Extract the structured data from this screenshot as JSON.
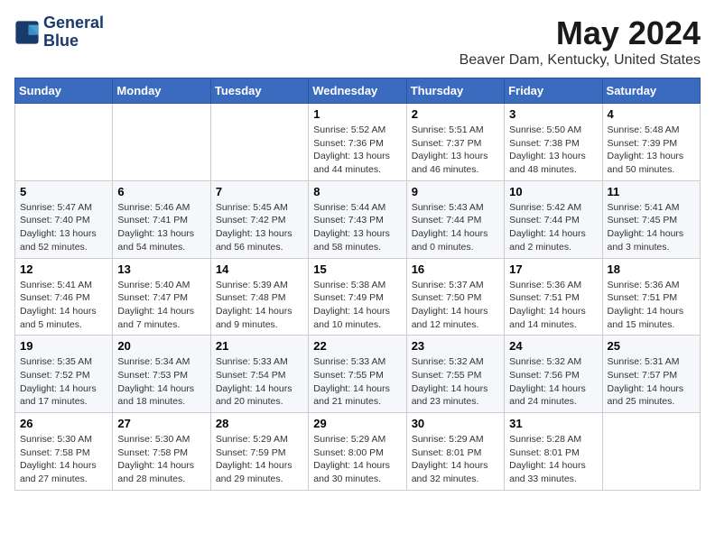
{
  "logo": {
    "line1": "General",
    "line2": "Blue"
  },
  "title": "May 2024",
  "subtitle": "Beaver Dam, Kentucky, United States",
  "weekdays": [
    "Sunday",
    "Monday",
    "Tuesday",
    "Wednesday",
    "Thursday",
    "Friday",
    "Saturday"
  ],
  "weeks": [
    [
      {
        "day": "",
        "info": ""
      },
      {
        "day": "",
        "info": ""
      },
      {
        "day": "",
        "info": ""
      },
      {
        "day": "1",
        "info": "Sunrise: 5:52 AM\nSunset: 7:36 PM\nDaylight: 13 hours\nand 44 minutes."
      },
      {
        "day": "2",
        "info": "Sunrise: 5:51 AM\nSunset: 7:37 PM\nDaylight: 13 hours\nand 46 minutes."
      },
      {
        "day": "3",
        "info": "Sunrise: 5:50 AM\nSunset: 7:38 PM\nDaylight: 13 hours\nand 48 minutes."
      },
      {
        "day": "4",
        "info": "Sunrise: 5:48 AM\nSunset: 7:39 PM\nDaylight: 13 hours\nand 50 minutes."
      }
    ],
    [
      {
        "day": "5",
        "info": "Sunrise: 5:47 AM\nSunset: 7:40 PM\nDaylight: 13 hours\nand 52 minutes."
      },
      {
        "day": "6",
        "info": "Sunrise: 5:46 AM\nSunset: 7:41 PM\nDaylight: 13 hours\nand 54 minutes."
      },
      {
        "day": "7",
        "info": "Sunrise: 5:45 AM\nSunset: 7:42 PM\nDaylight: 13 hours\nand 56 minutes."
      },
      {
        "day": "8",
        "info": "Sunrise: 5:44 AM\nSunset: 7:43 PM\nDaylight: 13 hours\nand 58 minutes."
      },
      {
        "day": "9",
        "info": "Sunrise: 5:43 AM\nSunset: 7:44 PM\nDaylight: 14 hours\nand 0 minutes."
      },
      {
        "day": "10",
        "info": "Sunrise: 5:42 AM\nSunset: 7:44 PM\nDaylight: 14 hours\nand 2 minutes."
      },
      {
        "day": "11",
        "info": "Sunrise: 5:41 AM\nSunset: 7:45 PM\nDaylight: 14 hours\nand 3 minutes."
      }
    ],
    [
      {
        "day": "12",
        "info": "Sunrise: 5:41 AM\nSunset: 7:46 PM\nDaylight: 14 hours\nand 5 minutes."
      },
      {
        "day": "13",
        "info": "Sunrise: 5:40 AM\nSunset: 7:47 PM\nDaylight: 14 hours\nand 7 minutes."
      },
      {
        "day": "14",
        "info": "Sunrise: 5:39 AM\nSunset: 7:48 PM\nDaylight: 14 hours\nand 9 minutes."
      },
      {
        "day": "15",
        "info": "Sunrise: 5:38 AM\nSunset: 7:49 PM\nDaylight: 14 hours\nand 10 minutes."
      },
      {
        "day": "16",
        "info": "Sunrise: 5:37 AM\nSunset: 7:50 PM\nDaylight: 14 hours\nand 12 minutes."
      },
      {
        "day": "17",
        "info": "Sunrise: 5:36 AM\nSunset: 7:51 PM\nDaylight: 14 hours\nand 14 minutes."
      },
      {
        "day": "18",
        "info": "Sunrise: 5:36 AM\nSunset: 7:51 PM\nDaylight: 14 hours\nand 15 minutes."
      }
    ],
    [
      {
        "day": "19",
        "info": "Sunrise: 5:35 AM\nSunset: 7:52 PM\nDaylight: 14 hours\nand 17 minutes."
      },
      {
        "day": "20",
        "info": "Sunrise: 5:34 AM\nSunset: 7:53 PM\nDaylight: 14 hours\nand 18 minutes."
      },
      {
        "day": "21",
        "info": "Sunrise: 5:33 AM\nSunset: 7:54 PM\nDaylight: 14 hours\nand 20 minutes."
      },
      {
        "day": "22",
        "info": "Sunrise: 5:33 AM\nSunset: 7:55 PM\nDaylight: 14 hours\nand 21 minutes."
      },
      {
        "day": "23",
        "info": "Sunrise: 5:32 AM\nSunset: 7:55 PM\nDaylight: 14 hours\nand 23 minutes."
      },
      {
        "day": "24",
        "info": "Sunrise: 5:32 AM\nSunset: 7:56 PM\nDaylight: 14 hours\nand 24 minutes."
      },
      {
        "day": "25",
        "info": "Sunrise: 5:31 AM\nSunset: 7:57 PM\nDaylight: 14 hours\nand 25 minutes."
      }
    ],
    [
      {
        "day": "26",
        "info": "Sunrise: 5:30 AM\nSunset: 7:58 PM\nDaylight: 14 hours\nand 27 minutes."
      },
      {
        "day": "27",
        "info": "Sunrise: 5:30 AM\nSunset: 7:58 PM\nDaylight: 14 hours\nand 28 minutes."
      },
      {
        "day": "28",
        "info": "Sunrise: 5:29 AM\nSunset: 7:59 PM\nDaylight: 14 hours\nand 29 minutes."
      },
      {
        "day": "29",
        "info": "Sunrise: 5:29 AM\nSunset: 8:00 PM\nDaylight: 14 hours\nand 30 minutes."
      },
      {
        "day": "30",
        "info": "Sunrise: 5:29 AM\nSunset: 8:01 PM\nDaylight: 14 hours\nand 32 minutes."
      },
      {
        "day": "31",
        "info": "Sunrise: 5:28 AM\nSunset: 8:01 PM\nDaylight: 14 hours\nand 33 minutes."
      },
      {
        "day": "",
        "info": ""
      }
    ]
  ]
}
